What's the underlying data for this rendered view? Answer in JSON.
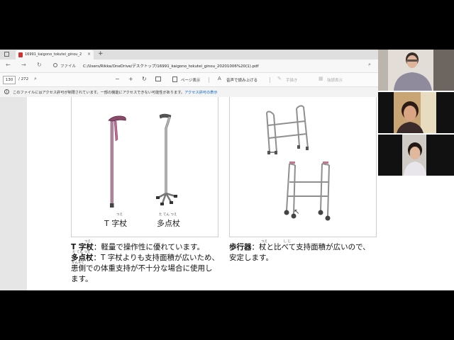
{
  "browser": {
    "tab_title": "16991_kaigono_tokutei_ginou_2",
    "tab_close": "×",
    "new_tab": "+",
    "back": "←",
    "forward": "→",
    "reload": "↻",
    "file_label": "ファイル",
    "url": "C:/Users/Rikka/OneDrive/デスクトップ/16991_kaigono_tokutei_ginou_20201006%20(1).pdf"
  },
  "pdf_toolbar": {
    "page_current": "130",
    "page_total": "/ 272",
    "zoom_out": "−",
    "zoom_in": "+",
    "page_view_label": "ページ表示",
    "read_aloud_label": "音声で読み上げる",
    "draw_label": "手描き",
    "highlight_label": "強調表示"
  },
  "infobar": {
    "message": "このファイルにはアクセス許可が制限されています。一部の機能にアクセスできない可能性があります。",
    "link": "アクセス許可の表示"
  },
  "document": {
    "left_caption_1": "T 字杖",
    "left_caption_1_ruby": "つえ",
    "left_caption_2": "多点杖",
    "left_caption_2_ruby": "た てん つえ",
    "text_line1_head": "T 字杖",
    "text_line1_rest": "：軽量で操作性に優れています。",
    "text_line2_head": "多点杖",
    "text_line2_rest": "：T 字杖よりも支持面積が広いため、",
    "text_line3": "患側での体重支持が不十分な場合に使用し",
    "text_line4": "ます。",
    "ruby_line2": "た てん つえ",
    "ruby_line3": "かんそく",
    "right_head": "歩行器",
    "right_rest": "：杖と比べて支持面積が広いので、",
    "right_line2": "安定します。",
    "right_ruby": "つえ　　　　　し じ"
  },
  "colors": {
    "cane_pink": "#b58aa0",
    "cane_handle": "#8a4a6a",
    "walker_frame": "#9a9a9a",
    "link_blue": "#0b63c4"
  }
}
